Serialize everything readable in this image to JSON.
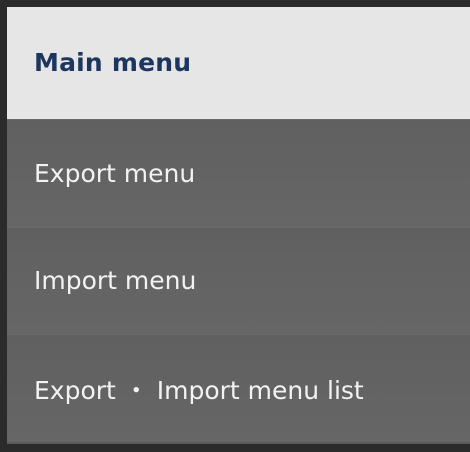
{
  "menu": {
    "header": "Main menu",
    "items": [
      {
        "label": "Export menu"
      },
      {
        "label": "Import menu"
      },
      {
        "label": "Export ・ Import menu list"
      }
    ]
  },
  "colors": {
    "header_bg": "#e6e6e6",
    "header_text": "#1d3660",
    "item_bg": "#636363",
    "item_text": "#f2f2f2",
    "frame": "#2b2b2b"
  }
}
